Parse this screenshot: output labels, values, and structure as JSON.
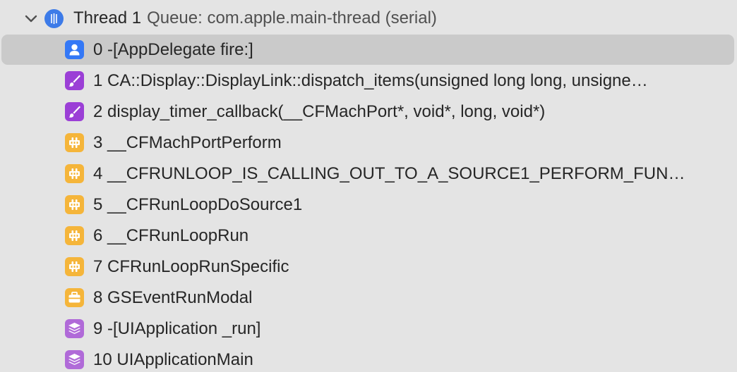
{
  "thread": {
    "name": "Thread 1",
    "queue": "Queue: com.apple.main-thread (serial)",
    "icon": "thread-icon",
    "expanded": true
  },
  "colors": {
    "background": "#e4e4e4",
    "selection": "#cacaca",
    "user_code": "#3478f6",
    "quartz_core": "#9b3fd6",
    "core_foundation": "#f5b53a",
    "graphics_services": "#f5b53a",
    "uikit": "#b06ad8"
  },
  "frames": [
    {
      "label": "0 -[AppDelegate fire:]",
      "icon": "person-icon",
      "selected": true
    },
    {
      "label": "1 CA::Display::DisplayLink::dispatch_items(unsigned long long, unsigne…",
      "icon": "brush-icon",
      "selected": false
    },
    {
      "label": "2 display_timer_callback(__CFMachPort*, void*, long, void*)",
      "icon": "brush-icon",
      "selected": false
    },
    {
      "label": "3 __CFMachPortPerform",
      "icon": "grid-icon",
      "selected": false
    },
    {
      "label": "4 __CFRUNLOOP_IS_CALLING_OUT_TO_A_SOURCE1_PERFORM_FUN…",
      "icon": "grid-icon",
      "selected": false
    },
    {
      "label": "5 __CFRunLoopDoSource1",
      "icon": "grid-icon",
      "selected": false
    },
    {
      "label": "6 __CFRunLoopRun",
      "icon": "grid-icon",
      "selected": false
    },
    {
      "label": "7 CFRunLoopRunSpecific",
      "icon": "grid-icon",
      "selected": false
    },
    {
      "label": "8 GSEventRunModal",
      "icon": "toolbox-icon",
      "selected": false
    },
    {
      "label": "9 -[UIApplication _run]",
      "icon": "layers-icon",
      "selected": false
    },
    {
      "label": "10 UIApplicationMain",
      "icon": "layers-icon",
      "selected": false
    }
  ]
}
